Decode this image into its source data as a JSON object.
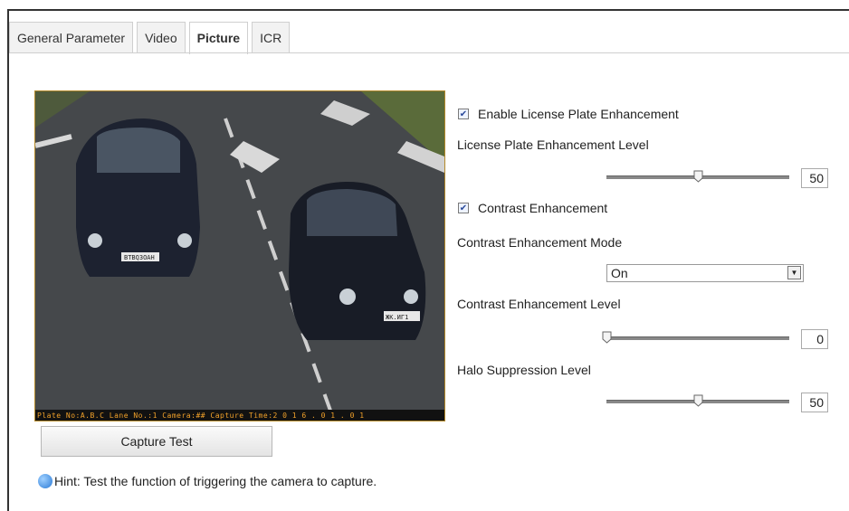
{
  "tabs": [
    {
      "label": "General Parameter",
      "active": false
    },
    {
      "label": "Video",
      "active": false
    },
    {
      "label": "Picture",
      "active": true
    },
    {
      "label": "ICR",
      "active": false
    }
  ],
  "preview": {
    "osd_text": "Plate No:A.B.C Lane No.:1 Camera:## Capture Time:2 0 1 6 . 0 1 . 0 1",
    "plate_left": "BTBQ3OAH",
    "plate_right": "ЖК.ИГ1"
  },
  "capture_button": "Capture Test",
  "hint": "Hint: Test the function of triggering the camera to capture.",
  "settings": {
    "enable_lpe": {
      "label": "Enable License Plate Enhancement",
      "checked": true
    },
    "lpe_level": {
      "label": "License Plate Enhancement Level",
      "value": 50,
      "min": 0,
      "max": 100
    },
    "contrast_enh": {
      "label": "Contrast Enhancement",
      "checked": true
    },
    "contrast_mode": {
      "label": "Contrast Enhancement Mode",
      "value": "On"
    },
    "contrast_level": {
      "label": "Contrast Enhancement Level",
      "value": 0,
      "min": 0,
      "max": 100
    },
    "halo_level": {
      "label": "Halo Suppression Level",
      "value": 50,
      "min": 0,
      "max": 100
    }
  }
}
